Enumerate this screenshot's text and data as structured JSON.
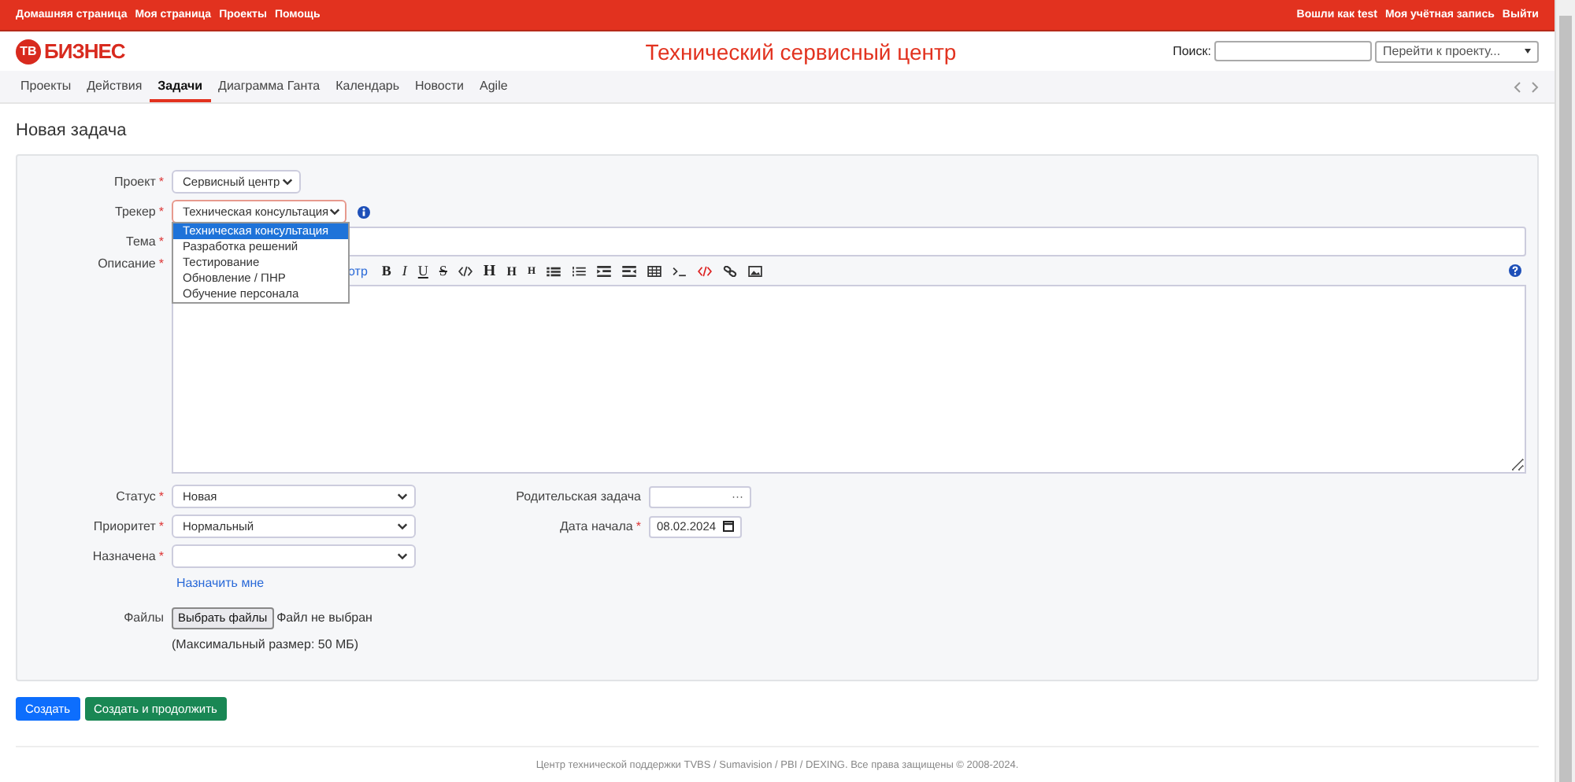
{
  "top_menu": {
    "left": [
      "Домашняя страница",
      "Моя страница",
      "Проекты",
      "Помощь"
    ],
    "logged_in": "Вошли как",
    "user": "test",
    "right": [
      "Моя учётная запись",
      "Выйти"
    ]
  },
  "header": {
    "logo_badge": "ТВ",
    "logo_text": "БИЗНЕС",
    "title": "Технический сервисный центр",
    "search_label": "Поиск:",
    "project_jump": "Перейти к проекту..."
  },
  "tabs": [
    {
      "label": "Проекты",
      "selected": false
    },
    {
      "label": "Действия",
      "selected": false
    },
    {
      "label": "Задачи",
      "selected": true
    },
    {
      "label": "Диаграмма Ганта",
      "selected": false
    },
    {
      "label": "Календарь",
      "selected": false
    },
    {
      "label": "Новости",
      "selected": false
    },
    {
      "label": "Agile",
      "selected": false
    }
  ],
  "page_title": "Новая задача",
  "form": {
    "project": {
      "label": "Проект",
      "value": "Сервисный центр"
    },
    "tracker": {
      "label": "Трекер",
      "value": "Техническая консультация",
      "expanded": true,
      "options": [
        {
          "label": "Техническая консультация",
          "selected": true
        },
        {
          "label": "Разработка решений",
          "selected": false
        },
        {
          "label": "Тестирование",
          "selected": false
        },
        {
          "label": "Обновление / ПНР",
          "selected": false
        },
        {
          "label": "Обучение персонала",
          "selected": false
        }
      ]
    },
    "subject": {
      "label": "Тема"
    },
    "description": {
      "label": "Описание",
      "preview_tab": "отр",
      "toolbar": [
        {
          "kind": "bold",
          "text": "B"
        },
        {
          "kind": "italic",
          "text": "I"
        },
        {
          "kind": "underline",
          "text": "U"
        },
        {
          "kind": "strike",
          "text": "S"
        },
        {
          "kind": "code"
        },
        {
          "kind": "h1",
          "text": "H"
        },
        {
          "kind": "h2",
          "text": "H"
        },
        {
          "kind": "h3",
          "text": "H"
        },
        {
          "kind": "ul"
        },
        {
          "kind": "ol"
        },
        {
          "kind": "indent"
        },
        {
          "kind": "outdent"
        },
        {
          "kind": "table"
        },
        {
          "kind": "pre"
        },
        {
          "kind": "html"
        },
        {
          "kind": "link"
        },
        {
          "kind": "image"
        }
      ]
    },
    "status": {
      "label": "Статус",
      "value": "Новая"
    },
    "priority": {
      "label": "Приоритет",
      "value": "Нормальный"
    },
    "assignee": {
      "label": "Назначена",
      "link": "Назначить мне"
    },
    "parent": {
      "label": "Родительская задача",
      "value": "···"
    },
    "start_date": {
      "label": "Дата начала",
      "value": "08.02.2024"
    },
    "files": {
      "label": "Файлы",
      "button": "Выбрать файлы",
      "state": "Файл не выбран",
      "note": "(Максимальный размер: 50 МБ)"
    },
    "required_mark": "*"
  },
  "buttons": [
    {
      "label": "Создать",
      "kind": "primary"
    },
    {
      "label": "Создать и продолжить",
      "kind": "success"
    }
  ],
  "footer": "Центр технической поддержки TVBS / Sumavision / PBI / DEXING. Все права защищены © 2008-2024."
}
